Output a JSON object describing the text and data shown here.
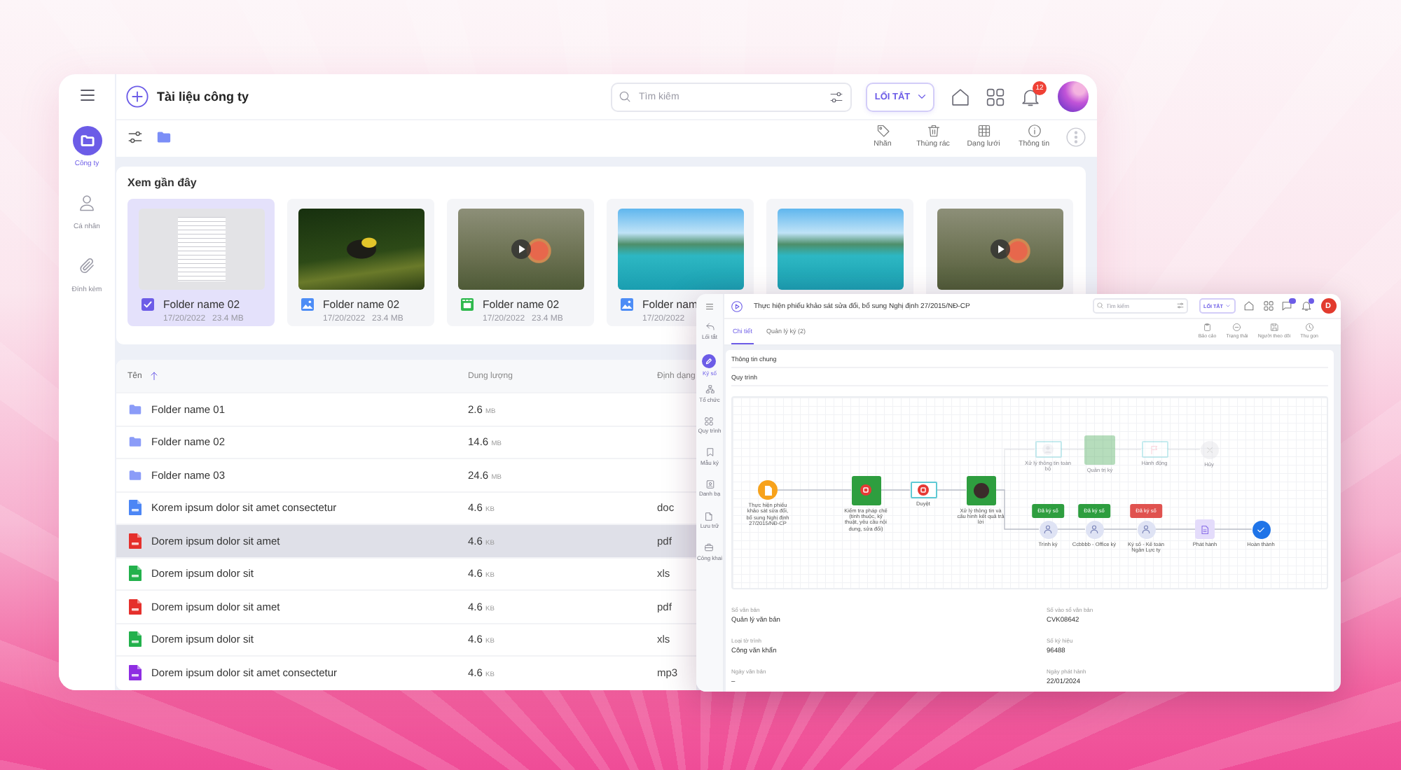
{
  "app_window": {
    "sidebar": {
      "items": [
        {
          "label": "Công ty",
          "selected": true
        },
        {
          "label": "Cá nhân",
          "selected": false
        },
        {
          "label": "Đính kèm",
          "selected": false
        }
      ]
    },
    "header": {
      "title": "Tài liệu công ty",
      "search": {
        "placeholder": "Tìm kiếm"
      },
      "shortcut_button": "LỐI TẮT",
      "notification_count": "12"
    },
    "toolbar": {
      "actions": [
        "Nhãn",
        "Thùng rác",
        "Dạng lưới",
        "Thông tin"
      ]
    },
    "recent": {
      "title": "Xem gần đây",
      "items": [
        {
          "kind": "document",
          "name": "Folder name 02",
          "date": "17/20/2022",
          "size": "23.4 MB",
          "selected": true
        },
        {
          "kind": "image",
          "name": "Folder name 02",
          "date": "17/20/2022",
          "size": "23.4 MB",
          "selected": false
        },
        {
          "kind": "video",
          "name": "Folder name 02",
          "date": "17/20/2022",
          "size": "23.4 MB",
          "selected": false
        },
        {
          "kind": "image",
          "name": "Folder nam",
          "date": "17/20/2022",
          "selected": false
        },
        {
          "kind": "image",
          "selected": false
        },
        {
          "kind": "video",
          "selected": false
        }
      ]
    },
    "table": {
      "columns": [
        {
          "label": "Tên",
          "sorted": true
        },
        {
          "label": "Dung lượng",
          "sorted": false
        },
        {
          "label": "Định dạng",
          "sorted": false
        }
      ],
      "rows": [
        {
          "kind": "folder",
          "name": "Folder name 01",
          "size": "2.6",
          "unit": "MB",
          "selected": false
        },
        {
          "kind": "folder",
          "name": "Folder name 02",
          "size": "14.6",
          "unit": "MB",
          "selected": false
        },
        {
          "kind": "folder",
          "name": "Folder name 03",
          "size": "24.6",
          "unit": "MB",
          "selected": false
        },
        {
          "kind": "doc",
          "name": "Korem ipsum dolor sit amet consectetur",
          "size": "4.6",
          "unit": "KB",
          "format": "doc",
          "selected": false
        },
        {
          "kind": "pdf",
          "name": "Dorem ipsum dolor sit amet",
          "size": "4.6",
          "unit": "KB",
          "format": "pdf",
          "selected": true
        },
        {
          "kind": "xls",
          "name": "Dorem ipsum dolor sit",
          "size": "4.6",
          "unit": "KB",
          "format": "xls",
          "selected": false
        },
        {
          "kind": "pdf",
          "name": "Dorem ipsum dolor sit amet",
          "size": "4.6",
          "unit": "KB",
          "format": "pdf",
          "selected": false
        },
        {
          "kind": "xls",
          "name": "Dorem ipsum dolor sit",
          "size": "4.6",
          "unit": "KB",
          "format": "xls",
          "selected": false
        },
        {
          "kind": "mp3",
          "name": "Dorem ipsum dolor sit amet consectetur",
          "size": "4.6",
          "unit": "KB",
          "format": "mp3",
          "selected": false
        }
      ]
    }
  },
  "detail_window": {
    "title": "Thực hiện phiếu khảo sát sửa đổi, bổ sung Nghị định 27/2015/NĐ-CP",
    "sidebar": {
      "items": [
        {
          "label": "Lối tắt",
          "selected": false
        },
        {
          "label": "Ký số",
          "selected": true
        },
        {
          "label": "Tổ chức",
          "selected": false
        },
        {
          "label": "Quy trình",
          "selected": false
        },
        {
          "label": "Mẫu ký",
          "selected": false
        },
        {
          "label": "Danh bạ",
          "selected": false
        },
        {
          "label": "Lưu trữ",
          "selected": false
        },
        {
          "label": "Công khai",
          "selected": false
        }
      ]
    },
    "search": {
      "placeholder": "Tìm kiếm"
    },
    "shortcut_button": "LỐI TẮT",
    "unread_messages": true,
    "unread_alerts": true,
    "avatar_initial": "D",
    "tabs": [
      {
        "label": "Chi tiết",
        "selected": true
      },
      {
        "label": "Quản lý ký (2)",
        "selected": false
      }
    ],
    "actions": [
      "Báo cáo",
      "Trạng thái",
      "Người theo dõi",
      "Thu gọn"
    ],
    "general_heading": "Thông tin chung",
    "process_heading": "Quy trình",
    "flow": {
      "main": [
        {
          "kind": "start",
          "label": "Thực hiện phiếu khảo sát sửa đổi, bổ sung Nghị định 27/2015/NĐ-CP",
          "faded": false
        },
        {
          "kind": "review",
          "label": "Kiểm tra pháp chế (tính thuộc, kỹ thuật, yêu cầu nội dung, sửa đổi)",
          "faded": false
        },
        {
          "kind": "approve",
          "label": "Duyệt",
          "faded": false
        },
        {
          "kind": "assign",
          "label": "Xử lý thông tin và cấu hình kết quả trả lời",
          "faded": false
        }
      ],
      "branches": [
        [
          {
            "kind": "assignee",
            "label": "Xử lý thông tin toàn bộ",
            "faded": true
          },
          {
            "kind": "group",
            "label": "Quản trị ký",
            "faded": true
          },
          {
            "kind": "action",
            "label": "Hành động",
            "faded": true
          },
          {
            "kind": "cancel",
            "label": "Hủy",
            "faded": true
          }
        ],
        [
          {
            "kind": "signer",
            "label": "Trình ký",
            "faded": false,
            "tag": {
              "label": "Đã ký số",
              "color": "#2e9e3f"
            }
          },
          {
            "kind": "signer",
            "label": "Ccbbbb - Office ký",
            "faded": false,
            "tag": {
              "label": "Đã ký số",
              "color": "#2e9e3f"
            }
          },
          {
            "kind": "signer",
            "label": "Ký số - Kế toán Ngân Lực ty",
            "faded": false,
            "tag": {
              "label": "Đã ký số",
              "color": "#e0524f"
            }
          },
          {
            "kind": "publish",
            "label": "Phát hành",
            "faded": false
          },
          {
            "kind": "finish",
            "label": "Hoàn thành",
            "faded": false
          }
        ]
      ]
    },
    "fields": [
      {
        "label": "Sổ văn bản",
        "value": "Quản lý văn bản"
      },
      {
        "label": "Số vào sổ văn bản",
        "value": "CVK08642"
      },
      {
        "label": "Loại tờ trình",
        "value": "Công văn khẩn"
      },
      {
        "label": "Số ký hiệu",
        "value": "96488"
      },
      {
        "label": "Ngày văn bản",
        "value": "–"
      },
      {
        "label": "Ngày phát hành",
        "value": "22/01/2024"
      }
    ]
  }
}
